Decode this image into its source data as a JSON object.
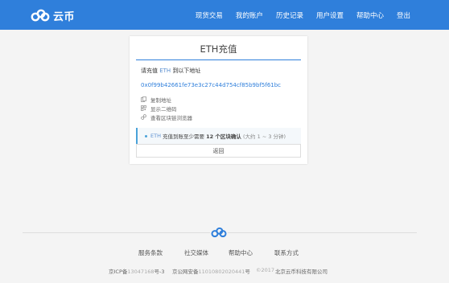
{
  "brand": {
    "name": "云币"
  },
  "nav": {
    "items": [
      "现货交易",
      "我的账户",
      "历史记录",
      "用户设置",
      "帮助中心",
      "登出"
    ]
  },
  "deposit": {
    "title": "ETH充值",
    "label_prefix": "请充值",
    "label_coin": "ETH",
    "label_suffix": "到以下地址",
    "address": "0x0f99b42661fe73e3c27c44d754cf85b9bf5f61bc",
    "actions": {
      "copy": "复制地址",
      "qrcode": "显示二维码",
      "explorer": "查看区块链浏览器"
    },
    "notice": {
      "coin": "ETH",
      "text1": "充值到账至少需要",
      "count": "12 个区块确认",
      "text2": "(大约 1 ~ 3 分钟)"
    },
    "back_label": "返回"
  },
  "footer": {
    "links": [
      "服务条款",
      "社交媒体",
      "帮助中心",
      "联系方式"
    ],
    "icp_prefix": "京ICP备",
    "icp_number": "13047168",
    "icp_suffix": "号-3",
    "police_prefix": "京公网安备",
    "police_number": "11010802020441",
    "police_suffix": "号",
    "year": "©2017",
    "company": "北京云币科技有限公司"
  },
  "colors": {
    "header": "#2f7fdb",
    "accent": "#2f7fdb",
    "notice_bar": "#4aa2d9"
  }
}
